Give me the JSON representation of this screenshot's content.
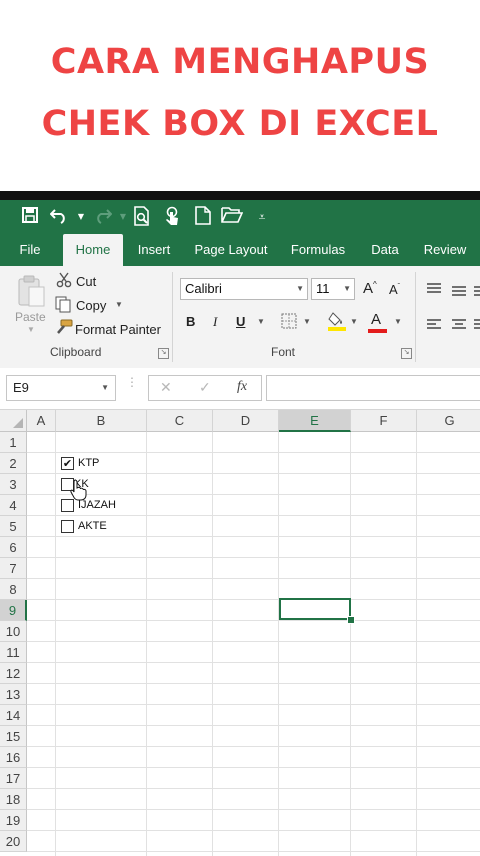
{
  "title": {
    "line1": "CARA MENGHAPUS",
    "line2": "CHEK BOX DI EXCEL"
  },
  "colors": {
    "title_red": "#ee4444",
    "excel_green": "#217346"
  },
  "qat": {
    "icons": [
      "save-icon",
      "undo-icon",
      "redo-icon",
      "print-preview-icon",
      "touch-mode-icon",
      "new-file-icon",
      "open-folder-icon",
      "customize-qat-icon"
    ]
  },
  "tabs": [
    "File",
    "Home",
    "Insert",
    "Page Layout",
    "Formulas",
    "Data",
    "Review"
  ],
  "active_tab": "Home",
  "clipboard": {
    "paste": "Paste",
    "cut": "Cut",
    "copy": "Copy",
    "format_painter": "Format Painter",
    "group_label": "Clipboard"
  },
  "font": {
    "name": "Calibri",
    "size": "11",
    "bold": "B",
    "italic": "I",
    "underline": "U",
    "grow": "A",
    "shrink": "A",
    "font_color": "A",
    "group_label": "Font"
  },
  "formula_bar": {
    "name_box": "E9",
    "cancel": "✕",
    "enter": "✓",
    "fx": "fx",
    "value": ""
  },
  "sheet": {
    "columns": [
      "A",
      "B",
      "C",
      "D",
      "E",
      "F",
      "G"
    ],
    "rows": [
      "1",
      "2",
      "3",
      "4",
      "5",
      "6",
      "7",
      "8",
      "9",
      "10",
      "11",
      "12",
      "13",
      "14",
      "15",
      "16",
      "17",
      "18",
      "19",
      "20"
    ],
    "selected_cell": "E9",
    "checkboxes": [
      {
        "label": "KTP",
        "checked": true
      },
      {
        "label": "KK",
        "checked": false
      },
      {
        "label": "IJAZAH",
        "checked": false
      },
      {
        "label": "AKTE",
        "checked": false
      }
    ]
  }
}
